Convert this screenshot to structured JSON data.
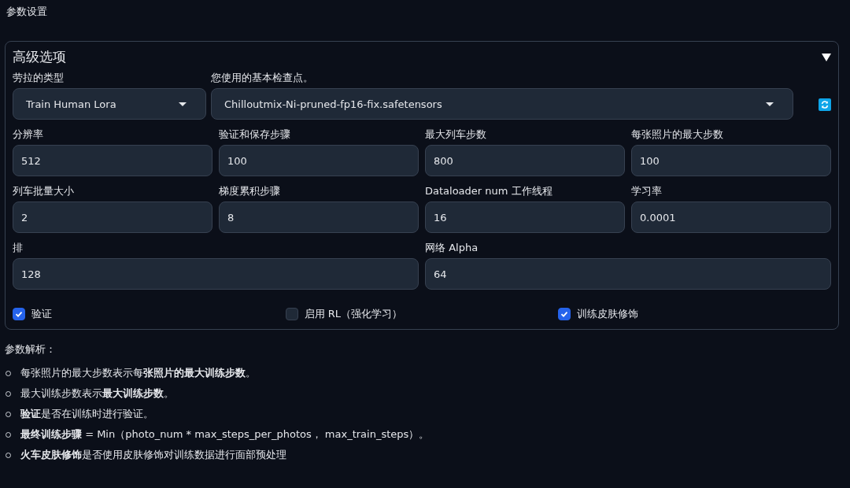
{
  "section_title": "参数设置",
  "panel": {
    "title": "高级选项",
    "expanded": true,
    "selects": [
      {
        "label": "劳拉的类型",
        "value": "Train Human Lora"
      },
      {
        "label": "您使用的基本检查点。",
        "value": "Chilloutmix-Ni-pruned-fp16-fix.safetensors"
      }
    ],
    "field_rows": [
      [
        {
          "label": "分辨率",
          "value": "512"
        },
        {
          "label": "验证和保存步骤",
          "value": "100"
        },
        {
          "label": "最大列车步数",
          "value": "800"
        },
        {
          "label": "每张照片的最大步数",
          "value": "100"
        }
      ],
      [
        {
          "label": "列车批量大小",
          "value": "2"
        },
        {
          "label": "梯度累积步骤",
          "value": "8"
        },
        {
          "label": "Dataloader num 工作线程",
          "value": "16"
        },
        {
          "label": "学习率",
          "value": "0.0001"
        }
      ],
      [
        {
          "label": "排",
          "value": "128"
        },
        {
          "label": "网络 Alpha",
          "value": "64"
        }
      ]
    ],
    "checkboxes": [
      {
        "label": "验证",
        "checked": true
      },
      {
        "label": "启用 RL（强化学习）",
        "checked": false
      },
      {
        "label": "训练皮肤修饰",
        "checked": true
      }
    ]
  },
  "notes_title": "参数解析：",
  "notes": [
    "每张照片的最大步数表示每**张照片的最大训练步数**。",
    "最大训练步数表示**最大训练步数**。",
    "**验证**是否在训练时进行验证。",
    "**最终训练步骤** = Min（photo_num * max_steps_per_photos， max_train_steps）。",
    "**火车皮肤修饰**是否使用皮肤修饰对训练数据进行面部预处理"
  ]
}
